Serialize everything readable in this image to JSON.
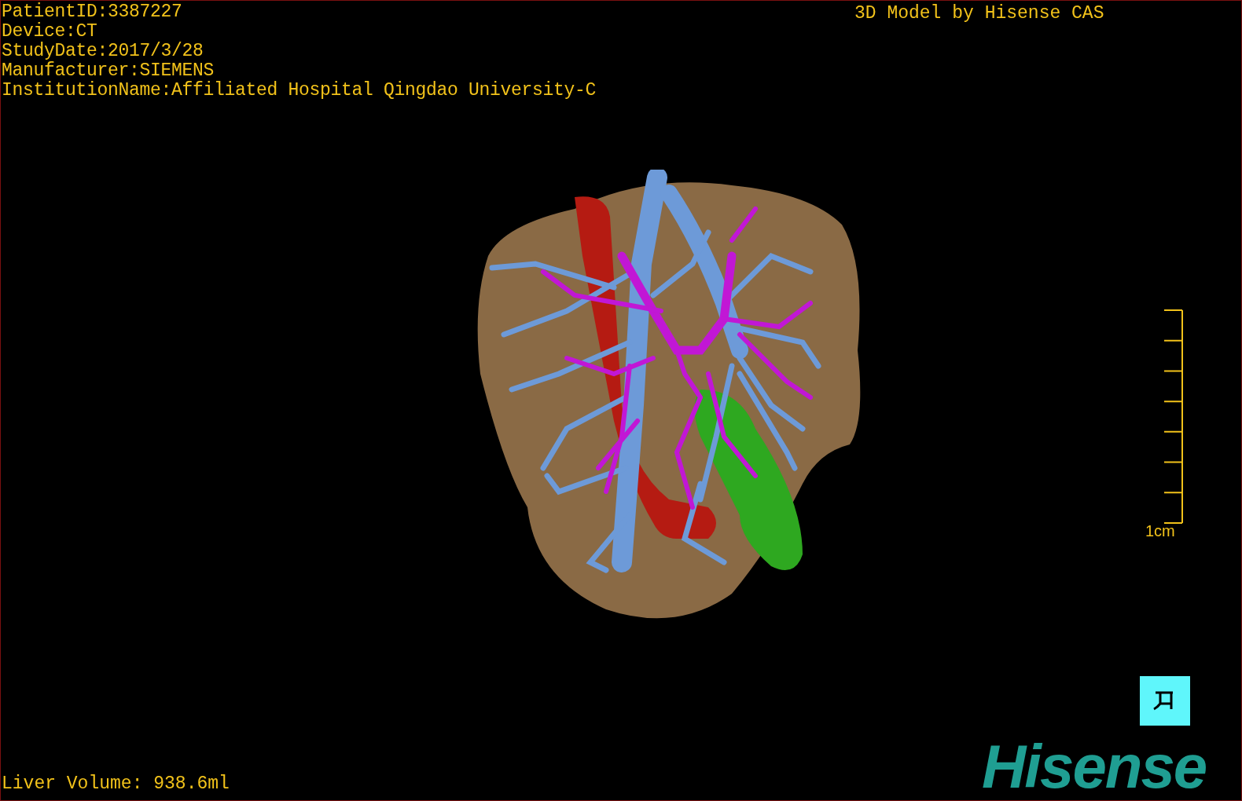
{
  "patient_info": [
    "PatientID:3387227",
    "Device:CT",
    "StudyDate:2017/3/28",
    "Manufacturer:SIEMENS",
    "InstitutionName:Affiliated Hospital Qingdao University-C"
  ],
  "title": "3D Model by Hisense CAS",
  "scale_label": "1cm",
  "liver_volume": "Liver Volume: 938.6ml",
  "logo": "Hisense"
}
